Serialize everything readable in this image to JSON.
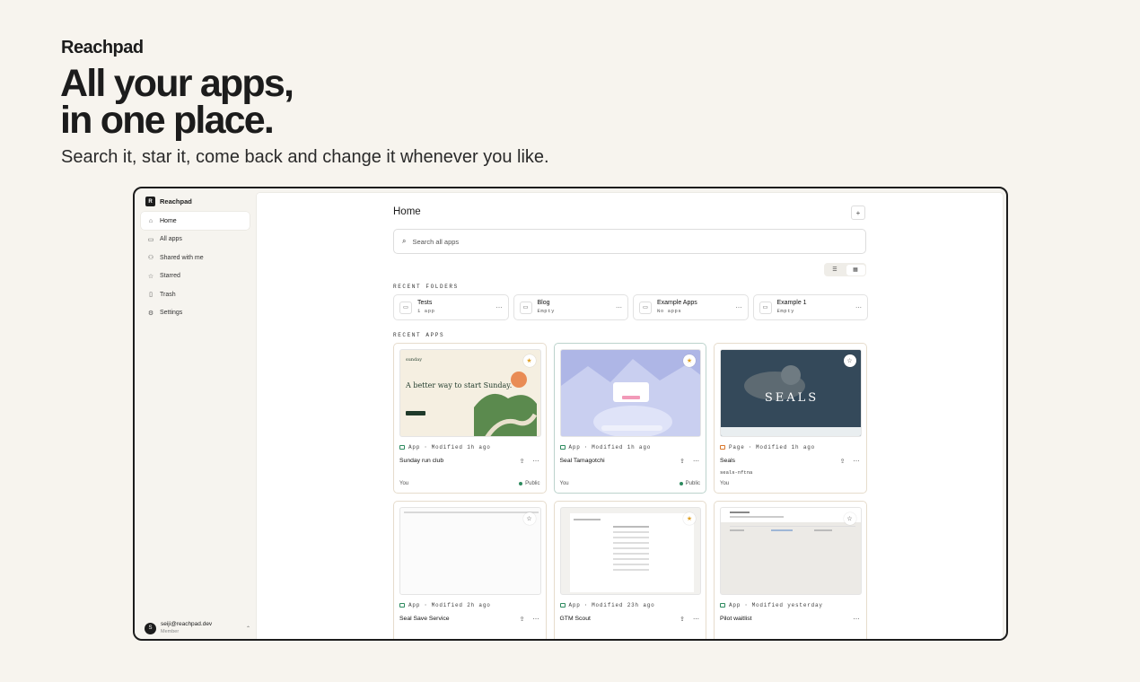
{
  "brand": "Reachpad",
  "hero": {
    "title_line1": "All your apps,",
    "title_line2": "in one place.",
    "subtitle": "Search it, star it, come back and change it whenever you like."
  },
  "sidebar": {
    "brand": "Reachpad",
    "logo_letter": "R",
    "items": [
      {
        "label": "Home",
        "icon": "home-icon",
        "active": true
      },
      {
        "label": "All apps",
        "icon": "folder-icon"
      },
      {
        "label": "Shared with me",
        "icon": "users-icon"
      },
      {
        "label": "Starred",
        "icon": "star-icon"
      },
      {
        "label": "Trash",
        "icon": "trash-icon"
      },
      {
        "label": "Settings",
        "icon": "gear-icon"
      }
    ],
    "user": {
      "email": "seiji@reachpad.dev",
      "role": "Member",
      "initial": "S"
    }
  },
  "main": {
    "title": "Home",
    "search_placeholder": "Search all apps",
    "recent_folders_label": "RECENT FOLDERS",
    "recent_apps_label": "RECENT APPS",
    "folders": [
      {
        "name": "Tests",
        "meta": "1 app"
      },
      {
        "name": "Blog",
        "meta": "Empty"
      },
      {
        "name": "Example Apps",
        "meta": "No apps"
      },
      {
        "name": "Example 1",
        "meta": "Empty"
      }
    ],
    "apps": [
      {
        "name": "Sunday run club",
        "type": "App",
        "modified": "Modified 1h ago",
        "owner": "You",
        "visibility": "Public",
        "starred": true,
        "thumb": "sunday",
        "thumb_text_1": "sunday",
        "thumb_text_2": "A better way to start Sunday."
      },
      {
        "name": "Seal Tamagotchi",
        "type": "App",
        "modified": "Modified 1h ago",
        "owner": "You",
        "visibility": "Public",
        "starred": true,
        "thumb": "tama"
      },
      {
        "name": "Seals",
        "type": "Page",
        "modified": "Modified 1h ago",
        "owner": "You",
        "slug": "seals-nftna",
        "starred": false,
        "thumb": "seals",
        "thumb_text_1": "SEALS"
      },
      {
        "name": "Seal Save Service",
        "type": "App",
        "modified": "Modified 2h ago",
        "starred": false,
        "thumb": "doc"
      },
      {
        "name": "GTM Scout",
        "type": "App",
        "modified": "Modified 23h ago",
        "starred": true,
        "thumb": "gtm"
      },
      {
        "name": "Pilot waitlist",
        "type": "App",
        "modified": "Modified yesterday",
        "starred": false,
        "thumb": "pilot"
      }
    ]
  },
  "colors": {
    "accent_green": "#2d8a5e",
    "star_gold": "#e0a126",
    "background": "#f7f4ee"
  }
}
